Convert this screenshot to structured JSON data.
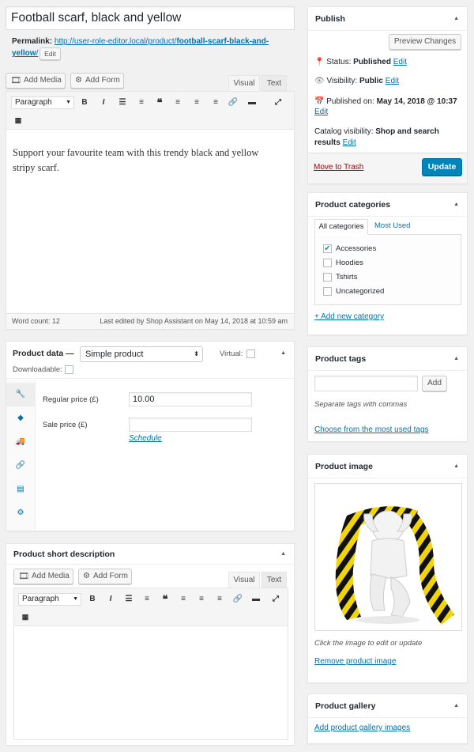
{
  "title_input": {
    "value": "Football scarf, black and yellow"
  },
  "permalink": {
    "label": "Permalink:",
    "url_base_line1": "http://user-role-editor.local/product/",
    "slug_line1": "football-scarf-black-and-",
    "slug_line2": "yellow",
    "trail": "/",
    "edit_label": "Edit"
  },
  "editor": {
    "add_media": "Add Media",
    "add_form": "Add Form",
    "tab_visual": "Visual",
    "tab_text": "Text",
    "format_select": "Paragraph",
    "content_line1": "Support your favourite team with this trendy black and yellow",
    "content_line2": "stripy scarf.",
    "word_count": "Word count: 12",
    "last_edited": "Last edited by Shop Assistant on May 14, 2018 at 10:59 am"
  },
  "product_data": {
    "title": "Product data —",
    "type_select": "Simple product",
    "virtual_label": "Virtual:",
    "downloadable_label": "Downloadable:",
    "regular_price_label": "Regular price (£)",
    "regular_price_value": "10.00",
    "sale_price_label": "Sale price (£)",
    "sale_price_value": "",
    "schedule_link": "Schedule"
  },
  "short_description": {
    "title": "Product short description",
    "add_media": "Add Media",
    "add_form": "Add Form",
    "tab_visual": "Visual",
    "tab_text": "Text",
    "format_select": "Paragraph"
  },
  "publish": {
    "title": "Publish",
    "preview_button": "Preview Changes",
    "status_label": "Status:",
    "status_value": "Published",
    "visibility_label": "Visibility:",
    "visibility_value": "Public",
    "published_label": "Published on:",
    "published_value": "May 14, 2018 @ 10:37",
    "catalog_label": "Catalog visibility:",
    "catalog_value_1": "Shop and search",
    "catalog_value_2": "results",
    "edit_label": "Edit",
    "trash_link": "Move to Trash",
    "update_button": "Update"
  },
  "categories": {
    "title": "Product categories",
    "tab_all": "All categories",
    "tab_most_used": "Most Used",
    "items": [
      {
        "label": "Accessories",
        "checked": true
      },
      {
        "label": "Hoodies",
        "checked": false
      },
      {
        "label": "Tshirts",
        "checked": false
      },
      {
        "label": "Uncategorized",
        "checked": false
      }
    ],
    "add_new_link": "+ Add new category"
  },
  "tags": {
    "title": "Product tags",
    "input_value": "",
    "add_button": "Add",
    "hint": "Separate tags with commas",
    "choose_link": "Choose from the most used tags"
  },
  "product_image": {
    "title": "Product image",
    "hint": "Click the image to edit or update",
    "remove_link": "Remove product image"
  },
  "gallery": {
    "title": "Product gallery",
    "add_link": "Add product gallery images"
  },
  "colors": {
    "accent": "#0073aa",
    "primary_button": "#0085ba",
    "trash": "#a00",
    "scarf_yellow": "#f2d40a"
  }
}
